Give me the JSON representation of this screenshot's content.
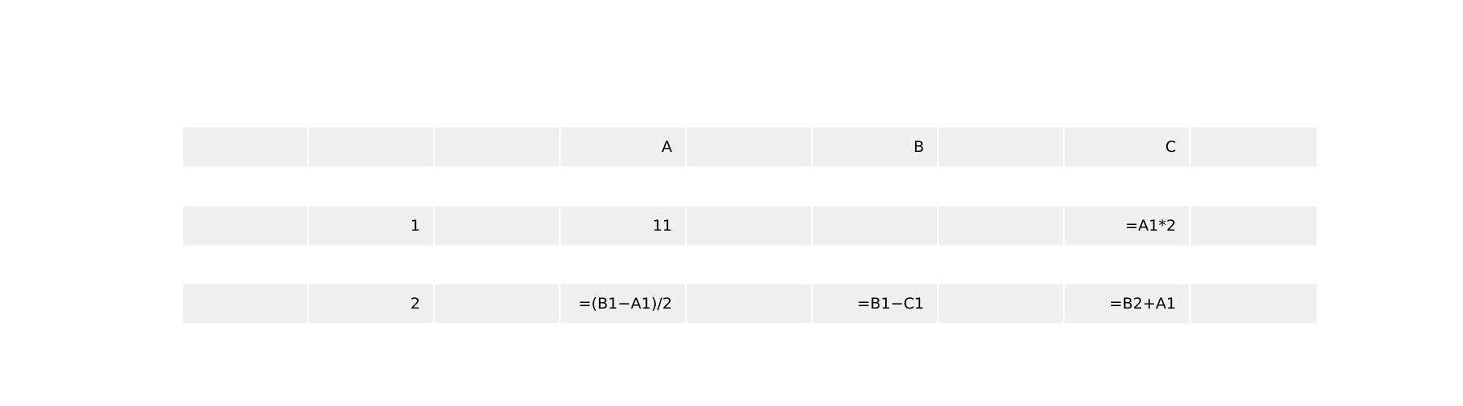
{
  "table": {
    "header": [
      "",
      "",
      "",
      "A",
      "",
      "B",
      "",
      "C",
      ""
    ],
    "rows": [
      [
        "",
        "1",
        "",
        "11",
        "",
        "",
        "",
        "=A1*2",
        ""
      ],
      [
        "",
        "2",
        "",
        "=(B1−A1)/2",
        "",
        "=B1−C1",
        "",
        "=B2+A1",
        ""
      ]
    ]
  },
  "colors": {
    "cell_background": "#f0f0f0",
    "separator": "#ffffff",
    "text": "#000000"
  }
}
